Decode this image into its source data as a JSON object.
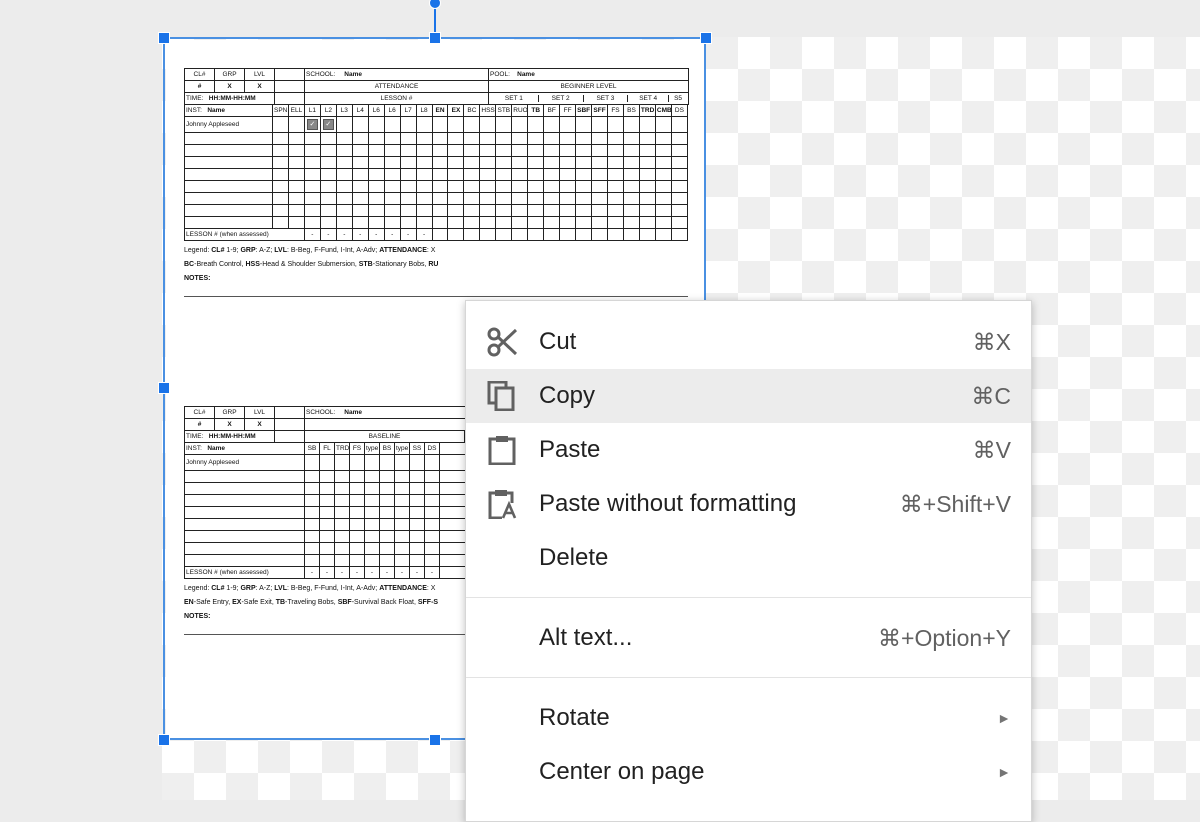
{
  "context_menu": {
    "items": [
      {
        "label": "Cut",
        "shortcut": "⌘X",
        "icon": "scissors-icon"
      },
      {
        "label": "Copy",
        "shortcut": "⌘C",
        "icon": "copy-icon"
      },
      {
        "label": "Paste",
        "shortcut": "⌘V",
        "icon": "clipboard-icon"
      },
      {
        "label": "Paste without formatting",
        "shortcut": "⌘+Shift+V",
        "icon": "clipboard-text-icon"
      },
      {
        "label": "Delete"
      },
      {
        "label": "Alt text...",
        "shortcut": "⌘+Option+Y"
      },
      {
        "label": "Rotate",
        "submenu": true
      },
      {
        "label": "Center on page",
        "submenu": true
      }
    ],
    "submenu_arrow": "►"
  },
  "document": {
    "sheet1": {
      "h_cl": "CL#",
      "h_grp": "GRP",
      "h_lvl": "LVL",
      "school_label": "SCHOOL:",
      "school_value": "Name",
      "pool_label": "POOL:",
      "pool_value": "Name",
      "v_cl": "#",
      "v_grp": "X",
      "v_lvl": "X",
      "attendance": "ATTENDANCE",
      "level": "BEGINNER LEVEL",
      "time_label": "TIME:",
      "time_value": "HH:MM-HH:MM",
      "lesson_label": "LESSON #",
      "set1": "SET 1",
      "set2": "SET 2",
      "set3": "SET 3",
      "set4": "SET 4",
      "s5": "S5",
      "inst_label": "INST:",
      "inst_value": "Name",
      "cols": [
        "SPN",
        "ELL",
        "L1",
        "L2",
        "L3",
        "L4",
        "L6",
        "L6",
        "L7",
        "L8",
        "EN",
        "EX",
        "BC",
        "HSS",
        "STB",
        "RUO",
        "TB",
        "BF",
        "FF",
        "SBF",
        "SFF",
        "FS",
        "BS",
        "TRD",
        "CMB",
        "DS"
      ],
      "student": "Johnny Appleseed",
      "lesson_row": "LESSON # (when assessed)",
      "dash": "-",
      "legend_1a": "Legend: ",
      "legend_1b": "CL#",
      "legend_1c": " 1-9; ",
      "legend_1d": "GRP",
      "legend_1e": ": A-Z; ",
      "legend_1f": "LVL",
      "legend_1g": ": B-Beg, F-Fund, I-Int, A-Adv; ",
      "legend_1h": "ATTENDANCE",
      "legend_1i": ": X",
      "legend_2a": "BC",
      "legend_2b": "-Breath Control, ",
      "legend_2c": "HSS",
      "legend_2d": "-Head & Shoulder Submersion, ",
      "legend_2e": "STB",
      "legend_2f": "-Stationary Bobs, ",
      "legend_2g": "RU",
      "notes": "NOTES:"
    },
    "sheet2": {
      "h_cl": "CL#",
      "h_grp": "GRP",
      "h_lvl": "LVL",
      "school_label": "SCHOOL:",
      "school_value": "Name",
      "v_cl": "#",
      "v_grp": "X",
      "v_lvl": "X",
      "baseline": "BASELINE",
      "time_label": "TIME:",
      "time_value": "HH:MM-HH:MM",
      "inst_label": "INST:",
      "inst_value": "Name",
      "cols": [
        "SB",
        "FL",
        "TRD",
        "FS",
        "type",
        "BS",
        "type",
        "SS",
        "DS"
      ],
      "student": "Johnny Appleseed",
      "lesson_row": "LESSON # (when assessed)",
      "dash": "-",
      "legend_1a": "Legend: ",
      "legend_1b": "CL#",
      "legend_1c": " 1-9; ",
      "legend_1d": "GRP",
      "legend_1e": ": A-Z; ",
      "legend_1f": "LVL",
      "legend_1g": ": B-Beg, F-Fund, I-Int, A-Adv; ",
      "legend_1h": "ATTENDANCE",
      "legend_1i": ": X",
      "legend_2a": "EN",
      "legend_2b": "-Safe Entry, ",
      "legend_2c": "EX",
      "legend_2d": "-Safe Exit, ",
      "legend_2e": "TB",
      "legend_2f": "-Traveling Bobs, ",
      "legend_2g": "SBF",
      "legend_2h": "-Survival Back Float, ",
      "legend_2i": "SFF-S",
      "notes": "NOTES:"
    }
  }
}
